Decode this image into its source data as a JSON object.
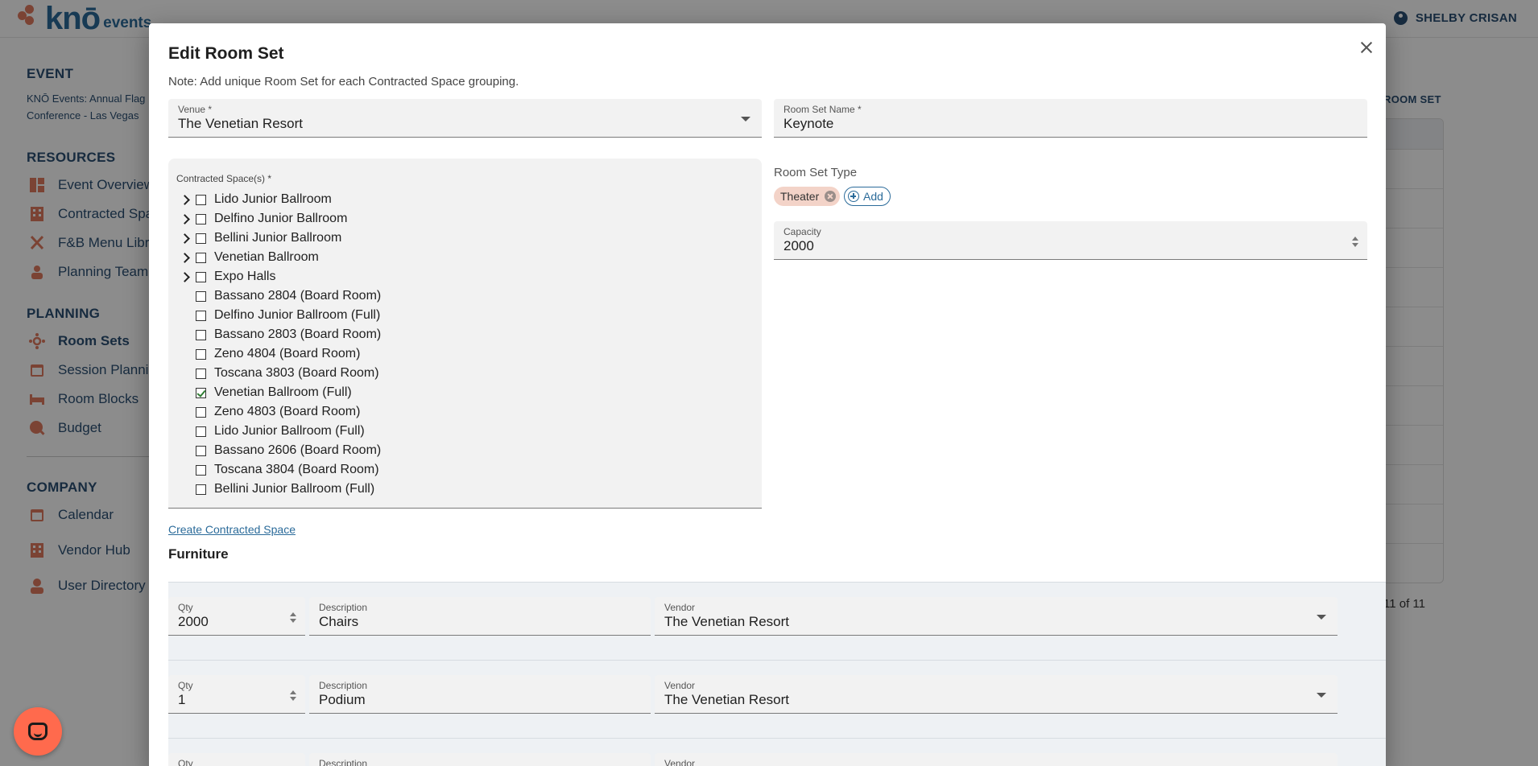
{
  "app": {
    "logo_text": "knō",
    "logo_sub": "events",
    "user_name": "SHELBY CRISAN"
  },
  "sidebar": {
    "event_heading": "EVENT",
    "event_name": "KNŌ Events: Annual Flag Conference - Las Vegas",
    "resources_heading": "RESOURCES",
    "resources": [
      {
        "label": "Event Overview",
        "icon": "event-overview-icon"
      },
      {
        "label": "Contracted Spaces",
        "icon": "building-icon"
      },
      {
        "label": "F&B Menu Library",
        "icon": "utensils-icon"
      },
      {
        "label": "Planning Team",
        "icon": "team-icon"
      }
    ],
    "planning_heading": "PLANNING",
    "planning": [
      {
        "label": "Room Sets",
        "icon": "room-sets-icon",
        "active": true
      },
      {
        "label": "Session Planning",
        "icon": "calendar-icon"
      },
      {
        "label": "Room Blocks",
        "icon": "bed-icon"
      },
      {
        "label": "Budget",
        "icon": "budget-icon"
      }
    ],
    "company_heading": "COMPANY",
    "company": [
      {
        "label": "Calendar",
        "icon": "calendar-icon"
      },
      {
        "label": "Vendor Hub",
        "icon": "building-icon"
      },
      {
        "label": "User Directory",
        "icon": "user-icon"
      }
    ]
  },
  "background": {
    "add_button": "ROOM SET",
    "pager": "11 of 11"
  },
  "modal": {
    "title": "Edit Room Set",
    "note": "Note: Add unique Room Set for each Contracted Space grouping.",
    "venue": {
      "label": "Venue *",
      "value": "The Venetian Resort"
    },
    "room_set_name": {
      "label": "Room Set Name *",
      "value": "Keynote"
    },
    "contracted_spaces": {
      "label": "Contracted Space(s) *",
      "items": [
        {
          "label": "Lido Junior Ballroom",
          "expandable": true,
          "checked": false
        },
        {
          "label": "Delfino Junior Ballroom",
          "expandable": true,
          "checked": false
        },
        {
          "label": "Bellini Junior Ballroom",
          "expandable": true,
          "checked": false
        },
        {
          "label": "Venetian Ballroom",
          "expandable": true,
          "checked": false
        },
        {
          "label": "Expo Halls",
          "expandable": true,
          "checked": false
        },
        {
          "label": "Bassano 2804 (Board Room)",
          "expandable": false,
          "checked": false
        },
        {
          "label": "Delfino Junior Ballroom (Full)",
          "expandable": false,
          "checked": false
        },
        {
          "label": "Bassano 2803 (Board Room)",
          "expandable": false,
          "checked": false
        },
        {
          "label": "Zeno 4804 (Board Room)",
          "expandable": false,
          "checked": false
        },
        {
          "label": "Toscana 3803 (Board Room)",
          "expandable": false,
          "checked": false
        },
        {
          "label": "Venetian Ballroom (Full)",
          "expandable": false,
          "checked": true
        },
        {
          "label": "Zeno 4803 (Board Room)",
          "expandable": false,
          "checked": false
        },
        {
          "label": "Lido Junior Ballroom (Full)",
          "expandable": false,
          "checked": false
        },
        {
          "label": "Bassano 2606 (Board Room)",
          "expandable": false,
          "checked": false
        },
        {
          "label": "Toscana 3804 (Board Room)",
          "expandable": false,
          "checked": false
        },
        {
          "label": "Bellini Junior Ballroom (Full)",
          "expandable": false,
          "checked": false
        }
      ]
    },
    "room_set_type": {
      "label": "Room Set Type",
      "chips": [
        "Theater"
      ],
      "add_label": "Add"
    },
    "capacity": {
      "label": "Capacity",
      "value": "2000"
    },
    "create_link": "Create Contracted Space",
    "furniture": {
      "title": "Furniture",
      "rows": [
        {
          "qty_label": "Qty",
          "qty": "2000",
          "desc_label": "Description",
          "desc": "Chairs",
          "vendor_label": "Vendor",
          "vendor": "The Venetian Resort"
        },
        {
          "qty_label": "Qty",
          "qty": "1",
          "desc_label": "Description",
          "desc": "Podium",
          "vendor_label": "Vendor",
          "vendor": "The Venetian Resort"
        },
        {
          "qty_label": "Qty",
          "qty": "",
          "desc_label": "Description",
          "desc": "",
          "vendor_label": "Vendor",
          "vendor": ""
        }
      ]
    }
  },
  "colors": {
    "brand": "#2b6b9a",
    "nav": "#2b4f73",
    "accent": "#e07a5f",
    "chat": "#ff6a4d",
    "chip": "#f3d3c8"
  }
}
